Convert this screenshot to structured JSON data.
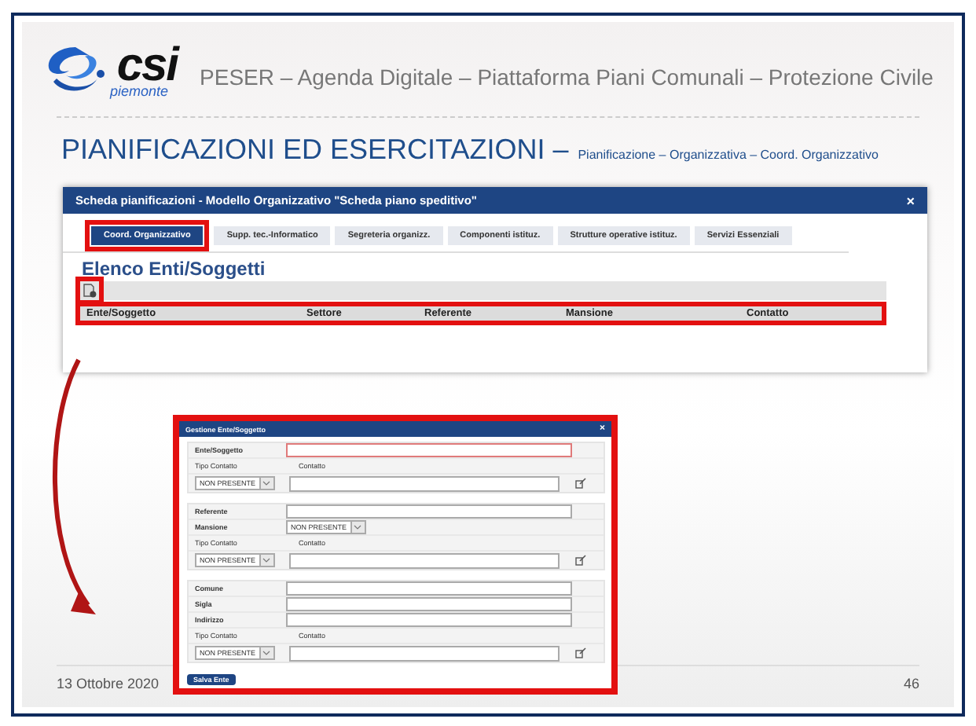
{
  "header": {
    "logo_text": "csi",
    "logo_subtext": "piemonte",
    "title": "PESER – Agenda Digitale – Piattaforma Piani Comunali – Protezione Civile"
  },
  "heading": {
    "main": "PIANIFICAZIONI ED ESERCITAZIONI –",
    "breadcrumb": "Pianificazione – Organizzativa – Coord. Organizzativo"
  },
  "window": {
    "title": "Scheda pianificazioni - Modello Organizzativo \"Scheda piano speditivo\"",
    "close": "×",
    "tabs": [
      {
        "label": "Coord. Organizzativo",
        "selected": true,
        "highlighted": true
      },
      {
        "label": "Supp. tec.-Informatico",
        "selected": false,
        "highlighted": false
      },
      {
        "label": "Segreteria organizz.",
        "selected": false,
        "highlighted": false
      },
      {
        "label": "Componenti istituz.",
        "selected": false,
        "highlighted": false
      },
      {
        "label": "Strutture operative istituz.",
        "selected": false,
        "highlighted": false
      },
      {
        "label": "Servizi Essenziali",
        "selected": false,
        "highlighted": false
      }
    ],
    "section_title": "Elenco Enti/Soggetti",
    "table": {
      "columns": [
        "Ente/Soggetto",
        "Settore",
        "Referente",
        "Mansione",
        "Contatto"
      ]
    }
  },
  "dialog": {
    "title": "Gestione Ente/Soggetto",
    "close": "×",
    "groups": [
      [
        {
          "kind": "text",
          "label": "Ente/Soggetto",
          "invalid": true
        },
        {
          "kind": "contact",
          "type_label": "Tipo Contatto",
          "contact_label": "Contatto",
          "value": "NON PRESENTE"
        }
      ],
      [
        {
          "kind": "text",
          "label": "Referente",
          "invalid": false
        },
        {
          "kind": "select",
          "label": "Mansione",
          "value": "NON PRESENTE"
        },
        {
          "kind": "contact",
          "type_label": "Tipo Contatto",
          "contact_label": "Contatto",
          "value": "NON PRESENTE"
        }
      ],
      [
        {
          "kind": "text",
          "label": "Comune",
          "invalid": false
        },
        {
          "kind": "text",
          "label": "Sigla",
          "invalid": false
        },
        {
          "kind": "text",
          "label": "Indirizzo",
          "invalid": false
        },
        {
          "kind": "contact",
          "type_label": "Tipo Contatto",
          "contact_label": "Contatto",
          "value": "NON PRESENTE"
        }
      ]
    ],
    "button": "Salva Ente"
  },
  "footer": {
    "date": "13 Ottobre 2020",
    "page": "46"
  }
}
